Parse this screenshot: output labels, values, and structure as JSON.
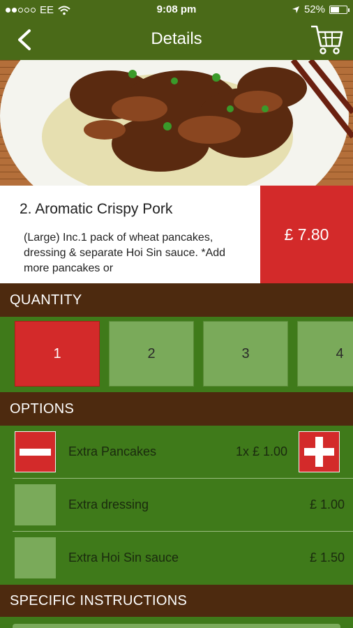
{
  "status_bar": {
    "carrier": "EE",
    "time": "9:08 pm",
    "battery": "52%"
  },
  "nav": {
    "title": "Details",
    "back_icon": "chevron-left-icon",
    "cart_icon": "cart-icon"
  },
  "product": {
    "name": "2. Aromatic Crispy Pork",
    "description": "(Large) Inc.1 pack of wheat pancakes, dressing & separate Hoi Sin sauce. *Add more pancakes or",
    "price": "£ 7.80"
  },
  "quantity": {
    "header": "QUANTITY",
    "options": [
      "1",
      "2",
      "3",
      "4"
    ],
    "selected": "1"
  },
  "options": {
    "header": "OPTIONS",
    "items": [
      {
        "label": "Extra Pancakes",
        "price": "1x £ 1.00",
        "selected": true
      },
      {
        "label": "Extra dressing",
        "price": "£ 1.00",
        "selected": false
      },
      {
        "label": "Extra Hoi Sin sauce",
        "price": "£ 1.50",
        "selected": false
      }
    ]
  },
  "instructions": {
    "header": "SPECIFIC INSTRUCTIONS"
  },
  "colors": {
    "nav_green": "#4a6a18",
    "body_green": "#3f7a1a",
    "tile_green": "#7aaa5a",
    "accent_red": "#d32a2a",
    "header_brown": "#4d2a0f"
  }
}
